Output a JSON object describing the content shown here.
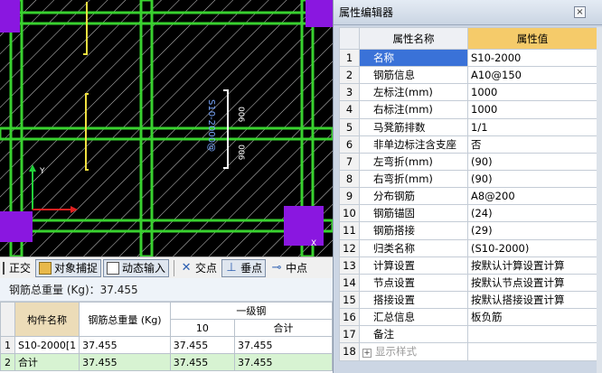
{
  "canvas": {
    "rebar_label": "S10-2000@",
    "dim_labels": [
      "006",
      "006"
    ],
    "axis": {
      "x": "X",
      "y": "Y"
    }
  },
  "toolbar": {
    "ortho": "正交",
    "snap": "对象捕捉",
    "dynamic": "动态输入",
    "intersection": "交点",
    "perpendicular": "垂点",
    "midpoint": "中点"
  },
  "weight": {
    "title": "钢筋总重量 (Kg)：37.455",
    "headers": {
      "name": "构件名称",
      "total": "钢筋总重量 (Kg)",
      "grade": "一级钢",
      "d10": "10",
      "sum": "合计"
    },
    "rows": [
      {
        "idx": "1",
        "name": "S10-2000[1",
        "total": "37.455",
        "d10": "37.455",
        "sum": "37.455"
      },
      {
        "idx": "2",
        "name": "合计",
        "total": "37.455",
        "d10": "37.455",
        "sum": "37.455"
      }
    ]
  },
  "properties": {
    "title": "属性编辑器",
    "close": "×",
    "col_name": "属性名称",
    "col_value": "属性值",
    "rows": [
      {
        "idx": "1",
        "name": "名称",
        "value": "S10-2000"
      },
      {
        "idx": "2",
        "name": "钢筋信息",
        "value": "A10@150"
      },
      {
        "idx": "3",
        "name": "左标注(mm)",
        "value": "1000"
      },
      {
        "idx": "4",
        "name": "右标注(mm)",
        "value": "1000"
      },
      {
        "idx": "5",
        "name": "马凳筋排数",
        "value": "1/1"
      },
      {
        "idx": "6",
        "name": "非单边标注含支座",
        "value": "否"
      },
      {
        "idx": "7",
        "name": "左弯折(mm)",
        "value": "(90)"
      },
      {
        "idx": "8",
        "name": "右弯折(mm)",
        "value": "(90)"
      },
      {
        "idx": "9",
        "name": "分布钢筋",
        "value": "A8@200"
      },
      {
        "idx": "10",
        "name": "钢筋锚固",
        "value": "(24)"
      },
      {
        "idx": "11",
        "name": "钢筋搭接",
        "value": "(29)"
      },
      {
        "idx": "12",
        "name": "归类名称",
        "value": "(S10-2000)"
      },
      {
        "idx": "13",
        "name": "计算设置",
        "value": "按默认计算设置计算"
      },
      {
        "idx": "14",
        "name": "节点设置",
        "value": "按默认节点设置计算"
      },
      {
        "idx": "15",
        "name": "搭接设置",
        "value": "按默认搭接设置计算"
      },
      {
        "idx": "16",
        "name": "汇总信息",
        "value": "板负筋"
      },
      {
        "idx": "17",
        "name": "备注",
        "value": ""
      },
      {
        "idx": "18",
        "name": "显示样式",
        "value": ""
      }
    ]
  }
}
